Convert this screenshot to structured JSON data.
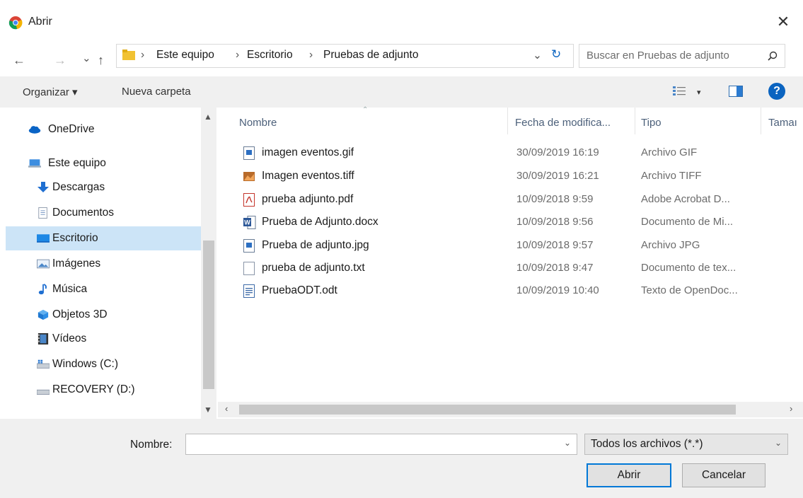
{
  "window": {
    "title": "Abrir",
    "close_glyph": "✕"
  },
  "nav": {
    "back": "←",
    "forward": "→",
    "recent": "⌄",
    "up": "↑",
    "refresh": "↻",
    "dropdown": "⌄"
  },
  "breadcrumb": [
    "Este equipo",
    "Escritorio",
    "Pruebas de adjunto"
  ],
  "search": {
    "placeholder": "Buscar en Pruebas de adjunto"
  },
  "toolbar": {
    "organize": "Organizar ▾",
    "new_folder": "Nueva carpeta",
    "view_dropdown": "▾",
    "help": "?"
  },
  "sidebar": {
    "items": [
      {
        "label": "OneDrive",
        "icon": "cloud-icon"
      },
      {
        "label": "Este equipo",
        "icon": "computer-icon"
      },
      {
        "label": "Descargas",
        "icon": "download-icon"
      },
      {
        "label": "Documentos",
        "icon": "document-icon"
      },
      {
        "label": "Escritorio",
        "icon": "desktop-icon",
        "selected": true
      },
      {
        "label": "Imágenes",
        "icon": "pictures-icon"
      },
      {
        "label": "Música",
        "icon": "music-icon"
      },
      {
        "label": "Objetos 3D",
        "icon": "cube-icon"
      },
      {
        "label": "Vídeos",
        "icon": "video-icon"
      },
      {
        "label": "Windows (C:)",
        "icon": "drive-icon"
      },
      {
        "label": "RECOVERY (D:)",
        "icon": "drive-icon"
      }
    ]
  },
  "columns": {
    "name": "Nombre",
    "date": "Fecha de modifica...",
    "type": "Tipo",
    "size": "Tamaı"
  },
  "files": [
    {
      "name": "imagen eventos.gif",
      "date": "30/09/2019 16:19",
      "type": "Archivo GIF",
      "icon": "image-file-icon"
    },
    {
      "name": "Imagen eventos.tiff",
      "date": "30/09/2019 16:21",
      "type": "Archivo TIFF",
      "icon": "photo-file-icon"
    },
    {
      "name": "prueba adjunto.pdf",
      "date": "10/09/2018 9:59",
      "type": "Adobe Acrobat D...",
      "icon": "pdf-file-icon"
    },
    {
      "name": "Prueba de Adjunto.docx",
      "date": "10/09/2018 9:56",
      "type": "Documento de Mi...",
      "icon": "word-file-icon"
    },
    {
      "name": "Prueba de adjunto.jpg",
      "date": "10/09/2018 9:57",
      "type": "Archivo JPG",
      "icon": "image-file-icon"
    },
    {
      "name": "prueba de adjunto.txt",
      "date": "10/09/2018 9:47",
      "type": "Documento de tex...",
      "icon": "text-file-icon"
    },
    {
      "name": "PruebaODT.odt",
      "date": "10/09/2019 10:40",
      "type": "Texto de OpenDoc...",
      "icon": "odt-file-icon"
    }
  ],
  "footer": {
    "name_label": "Nombre:",
    "name_value": "",
    "filter": "Todos los archivos (*.*)",
    "open": "Abrir",
    "cancel": "Cancelar"
  },
  "colors": {
    "selection": "#cce4f7",
    "accent": "#0078d7"
  }
}
